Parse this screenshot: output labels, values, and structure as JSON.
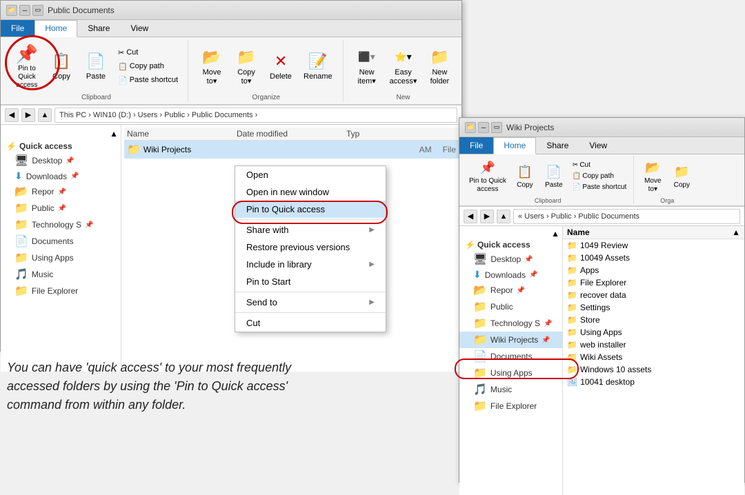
{
  "mainWindow": {
    "title": "Public Documents",
    "tabs": [
      "File",
      "Home",
      "Share",
      "View"
    ],
    "activeTab": "Home",
    "ribbon": {
      "groups": [
        {
          "label": "Clipboard",
          "buttons": [
            {
              "id": "pin",
              "label": "Pin to Quick\naccess",
              "icon": "📌",
              "type": "large"
            },
            {
              "id": "copy",
              "label": "Copy",
              "icon": "📋",
              "type": "large"
            },
            {
              "id": "paste",
              "label": "Paste",
              "icon": "📄",
              "type": "large"
            }
          ],
          "smallButtons": [
            {
              "id": "cut",
              "label": "Cut",
              "icon": "✂"
            },
            {
              "id": "copypath",
              "label": "Copy path",
              "icon": "📋"
            },
            {
              "id": "pasteshortcut",
              "label": "Paste shortcut",
              "icon": "📄"
            }
          ]
        },
        {
          "label": "Organize",
          "buttons": [
            {
              "id": "moveto",
              "label": "Move\nto▾",
              "icon": "📂",
              "type": "large"
            },
            {
              "id": "copyto",
              "label": "Copy\nto▾",
              "icon": "📁",
              "type": "large"
            },
            {
              "id": "delete",
              "label": "Delete",
              "icon": "🗑",
              "type": "large"
            },
            {
              "id": "rename",
              "label": "Rename",
              "icon": "📝",
              "type": "large"
            }
          ]
        },
        {
          "label": "New",
          "buttons": [
            {
              "id": "newitem",
              "label": "New item▾",
              "icon": "⬜",
              "type": "large"
            },
            {
              "id": "easeyaccess",
              "label": "Easy access▾",
              "icon": "⭐",
              "type": "large"
            },
            {
              "id": "newfolder",
              "label": "New\nfolder",
              "icon": "📁",
              "type": "large"
            }
          ]
        }
      ]
    },
    "addressBar": {
      "path": "This PC › WIN10 (D:) › Users › Public › Public Documents ›"
    },
    "sidebar": {
      "sections": [
        {
          "header": "⚡ Quick access",
          "items": [
            {
              "name": "Desktop",
              "icon": "🖥",
              "pinned": true
            },
            {
              "name": "Downloads",
              "icon": "⬇",
              "pinned": true
            },
            {
              "name": "Reports",
              "icon": "📂",
              "pinned": true
            },
            {
              "name": "Public",
              "icon": "📁",
              "pinned": true
            },
            {
              "name": "Technology S",
              "icon": "📁",
              "pinned": true
            },
            {
              "name": "Documents",
              "icon": "📄",
              "pinned": false
            },
            {
              "name": "Using Apps",
              "icon": "📁",
              "pinned": false
            },
            {
              "name": "Music",
              "icon": "🎵",
              "pinned": false
            },
            {
              "name": "File Explorer",
              "icon": "📁",
              "pinned": false
            }
          ]
        }
      ]
    },
    "fileList": {
      "columns": [
        "Name",
        "Date modified",
        "Type"
      ],
      "files": [
        {
          "name": "Wiki Projects",
          "icon": "📁",
          "date": "AM",
          "type": "File",
          "selected": true
        }
      ]
    }
  },
  "contextMenu": {
    "items": [
      {
        "id": "open",
        "label": "Open",
        "arrow": false
      },
      {
        "id": "openwindow",
        "label": "Open in new window",
        "arrow": false
      },
      {
        "id": "pintoquick",
        "label": "Pin to Quick access",
        "arrow": false,
        "highlighted": true
      },
      {
        "id": "separator1",
        "type": "separator"
      },
      {
        "id": "sharewith",
        "label": "Share with",
        "arrow": true
      },
      {
        "id": "restore",
        "label": "Restore previous versions",
        "arrow": false
      },
      {
        "id": "includeinlib",
        "label": "Include in library",
        "arrow": true
      },
      {
        "id": "pintostart",
        "label": "Pin to Start",
        "arrow": false
      },
      {
        "id": "separator2",
        "type": "separator"
      },
      {
        "id": "sendto",
        "label": "Send to",
        "arrow": true
      },
      {
        "id": "separator3",
        "type": "separator"
      },
      {
        "id": "cut",
        "label": "Cut",
        "arrow": false
      }
    ]
  },
  "description": "You can have 'quick access' to your most frequently accessed folders by using the 'Pin to Quick access' command from within any folder.",
  "secondWindow": {
    "title": "Wiki Projects",
    "tabs": [
      "File",
      "Home",
      "Share",
      "View"
    ],
    "activeTab": "Home",
    "ribbon": {
      "buttons": [
        {
          "id": "pin2",
          "label": "Pin to Quick\naccess",
          "icon": "📌",
          "type": "large"
        },
        {
          "id": "copy2",
          "label": "Copy",
          "icon": "📋",
          "type": "large"
        },
        {
          "id": "paste2",
          "label": "Paste",
          "icon": "📄",
          "type": "large"
        }
      ],
      "smallButtons": [
        {
          "id": "cut2",
          "label": "Cut",
          "icon": "✂"
        },
        {
          "id": "copypath2",
          "label": "Copy path",
          "icon": "📋"
        },
        {
          "id": "pasteshortcut2",
          "label": "Paste shortcut",
          "icon": "📄"
        }
      ],
      "organizeButtons": [
        {
          "id": "moveto2",
          "label": "Move\nto▾",
          "icon": "📂"
        }
      ],
      "groupLabel": "Clipboard",
      "organizeLabel": "Orga"
    },
    "addressBar": {
      "path": "« Users › Public › Public Documents"
    },
    "sidebar": {
      "sections": [
        {
          "header": "⚡ Quick access",
          "items": [
            {
              "name": "Desktop",
              "icon": "🖥",
              "pinned": true
            },
            {
              "name": "Downloads",
              "icon": "⬇",
              "pinned": true
            },
            {
              "name": "Reports",
              "icon": "📂",
              "pinned": true
            },
            {
              "name": "Public",
              "icon": "📁",
              "pinned": false
            },
            {
              "name": "Technology S",
              "icon": "📁",
              "pinned": true
            },
            {
              "name": "Wiki Projects",
              "icon": "📁",
              "pinned": true,
              "highlighted": true
            },
            {
              "name": "Documents",
              "icon": "📄",
              "pinned": false
            },
            {
              "name": "Using Apps",
              "icon": "📁",
              "pinned": false
            },
            {
              "name": "Music",
              "icon": "🎵",
              "pinned": false
            },
            {
              "name": "File Explorer",
              "icon": "📁",
              "pinned": false
            }
          ]
        }
      ]
    },
    "fileList": {
      "files": [
        {
          "name": "1049 Review",
          "icon": "📁"
        },
        {
          "name": "10049 Assets",
          "icon": "📁"
        },
        {
          "name": "Apps",
          "icon": "📁"
        },
        {
          "name": "File Explorer",
          "icon": "📁"
        },
        {
          "name": "recover data",
          "icon": "📁"
        },
        {
          "name": "Settings",
          "icon": "📁"
        },
        {
          "name": "Store",
          "icon": "📁"
        },
        {
          "name": "Using Apps",
          "icon": "📁"
        },
        {
          "name": "web installer",
          "icon": "📁"
        },
        {
          "name": "Wiki Assets",
          "icon": "📁"
        },
        {
          "name": "Windows 10 assets",
          "icon": "📁"
        },
        {
          "name": "10041 desktop",
          "icon": "🖼"
        }
      ]
    }
  }
}
